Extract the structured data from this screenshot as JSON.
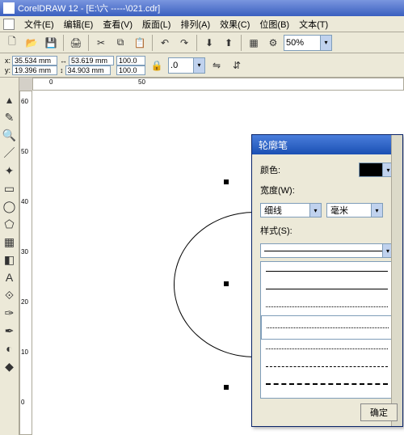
{
  "app": {
    "title": "CorelDRAW 12 - [E:\\六 -----\\021.cdr]"
  },
  "menu": {
    "file": "文件(E)",
    "edit": "编辑(E)",
    "view": "查看(V)",
    "layout": "版面(L)",
    "arrange": "排列(A)",
    "effects": "效果(C)",
    "bitmap": "位图(B)",
    "text": "文本(T)"
  },
  "zoom": {
    "value": "50%"
  },
  "coords": {
    "x": "35.534 mm",
    "y": "19.396 mm",
    "w": "53.619 mm",
    "h": "34.903 mm",
    "sx": "100.0",
    "sy": "100.0",
    "rot": ".0"
  },
  "dialog": {
    "title": "轮廓笔",
    "color_label": "颜色:",
    "width_label": "宽度(W):",
    "width_value": "细线",
    "unit_value": "毫米",
    "style_label": "样式(S):",
    "ok": "确定"
  },
  "ruler_h": [
    "0",
    "50"
  ],
  "ruler_v": [
    "60",
    "50",
    "40",
    "30",
    "20",
    "10",
    "0"
  ]
}
